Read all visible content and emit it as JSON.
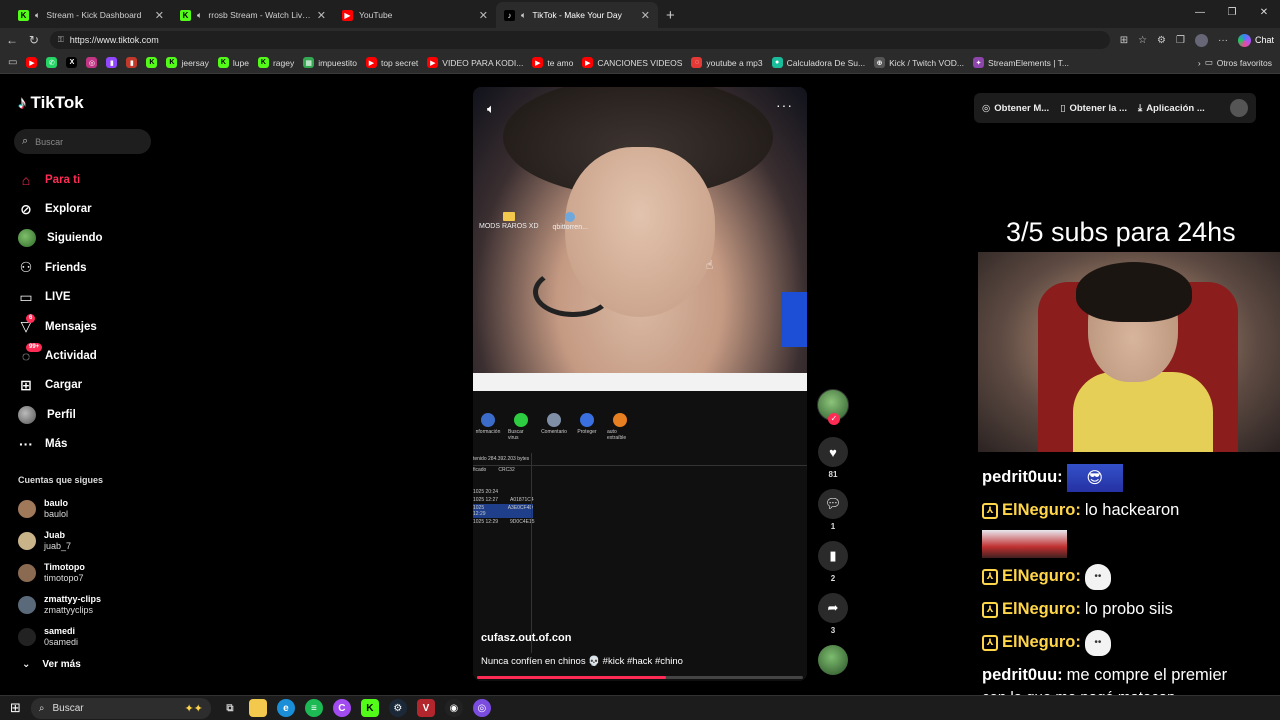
{
  "browser": {
    "tabs": [
      {
        "title": "Stream - Kick Dashboard",
        "fav": "K",
        "fav_color": "#53fc18",
        "audio": true,
        "active": false
      },
      {
        "title": "rrosb Stream - Watch Live on",
        "fav": "K",
        "fav_color": "#53fc18",
        "audio": true,
        "active": false
      },
      {
        "title": "YouTube",
        "fav": "▶",
        "fav_color": "#ff0000",
        "audio": false,
        "active": false
      },
      {
        "title": "TikTok - Make Your Day",
        "fav": "♪",
        "fav_color": "#000000",
        "audio": true,
        "active": true
      }
    ],
    "url": "https://www.tiktok.com",
    "chat_label": "Chat",
    "bookmarks": [
      {
        "label": "",
        "icon": "▶",
        "color": "#ff0000"
      },
      {
        "label": "",
        "icon": "✆",
        "color": "#25d366"
      },
      {
        "label": "",
        "icon": "X",
        "color": "#000000"
      },
      {
        "label": "",
        "icon": "◎",
        "color": "#c13584"
      },
      {
        "label": "",
        "icon": "▮",
        "color": "#9146ff"
      },
      {
        "label": "",
        "icon": "▮",
        "color": "#c0392b"
      },
      {
        "label": "",
        "icon": "K",
        "color": "#53fc18"
      },
      {
        "label": "jeersay",
        "icon": "K",
        "color": "#53fc18"
      },
      {
        "label": "lupe",
        "icon": "K",
        "color": "#53fc18"
      },
      {
        "label": "ragey",
        "icon": "K",
        "color": "#53fc18"
      },
      {
        "label": "impuestito",
        "icon": "▦",
        "color": "#34a853"
      },
      {
        "label": "top secret",
        "icon": "▶",
        "color": "#ff0000"
      },
      {
        "label": "VIDEO PARA KODI...",
        "icon": "▶",
        "color": "#ff0000"
      },
      {
        "label": "te amo",
        "icon": "▶",
        "color": "#ff0000"
      },
      {
        "label": "CANCIONES VIDEOS",
        "icon": "▶",
        "color": "#ff0000"
      },
      {
        "label": "youtube a mp3",
        "icon": "◌",
        "color": "#e53935"
      },
      {
        "label": "Calculadora De Su...",
        "icon": "●",
        "color": "#1abc9c"
      },
      {
        "label": "Kick / Twitch VOD...",
        "icon": "⊕",
        "color": "#555555"
      },
      {
        "label": "StreamElements | T...",
        "icon": "✦",
        "color": "#8e44ad"
      }
    ],
    "other_bookmarks": "Otros favoritos"
  },
  "tiktok": {
    "logo": "TikTok",
    "search_placeholder": "Buscar",
    "menu": [
      {
        "label": "Para ti",
        "icon": "⌂",
        "active": true,
        "badge": ""
      },
      {
        "label": "Explorar",
        "icon": "⊘",
        "active": false,
        "badge": ""
      },
      {
        "label": "Siguiendo",
        "icon": "",
        "active": false,
        "badge": ""
      },
      {
        "label": "Friends",
        "icon": "⚇",
        "active": false,
        "badge": ""
      },
      {
        "label": "LIVE",
        "icon": "▭",
        "active": false,
        "badge": ""
      },
      {
        "label": "Mensajes",
        "icon": "▽",
        "active": false,
        "badge": "6"
      },
      {
        "label": "Actividad",
        "icon": "",
        "active": false,
        "badge": "99+"
      },
      {
        "label": "Cargar",
        "icon": "⊞",
        "active": false,
        "badge": ""
      },
      {
        "label": "Perfil",
        "icon": "",
        "active": false,
        "badge": ""
      },
      {
        "label": "Más",
        "icon": "···",
        "active": false,
        "badge": ""
      }
    ],
    "following_title": "Cuentas que sigues",
    "accounts": [
      {
        "name": "baulo",
        "handle": "baulol",
        "color": "#a0785a"
      },
      {
        "name": "Juab",
        "handle": "juab_7",
        "color": "#c9b48a"
      },
      {
        "name": "Timotopo",
        "handle": "timotopo7",
        "color": "#8a6a50"
      },
      {
        "name": "zmattyy-clips",
        "handle": "zmattyyclips",
        "color": "#5a6a7a"
      },
      {
        "name": "samedi",
        "handle": "0samedi",
        "color": "#222222"
      }
    ],
    "see_more": "Ver más",
    "top_buttons": [
      "Obtener M...",
      "Obtener la ...",
      "Aplicación ..."
    ],
    "video": {
      "author": "cufasz.out.of.con",
      "caption": "Nunca confíen en chinos 💀 #kick #hack #chino",
      "progress": 0.58,
      "desktop_icons": [
        "MODS RAROS XD",
        "qbittorren..."
      ],
      "tools": [
        "nformación",
        "Buscar virus",
        "Comentario",
        "Proteger",
        "auto extraíble"
      ],
      "file_header": "tenido 284.392.203 bytes",
      "file_cols": [
        "ficado",
        "CRC32"
      ],
      "file_rows": [
        {
          "date": "1025 20:24",
          "crc": ""
        },
        {
          "date": "1025 12:27",
          "crc": "A01871C4"
        },
        {
          "date": "1025 12:29",
          "crc": "A3E0CF4D"
        },
        {
          "date": "1025 12:29",
          "crc": "9D0C4E15"
        }
      ]
    },
    "actions": {
      "likes": "81",
      "comments": "1",
      "saves": "2",
      "shares": "3"
    }
  },
  "stream_overlay": {
    "goal": "3/5 subs para 24hs",
    "chat": [
      {
        "user": "pedrit0uu",
        "text": "",
        "sub": false,
        "emote": "pedrito"
      },
      {
        "user": "ElNeguro",
        "text": "lo hackearon",
        "sub": true,
        "emote": ""
      },
      {
        "user": "",
        "text": "",
        "sub": false,
        "emote": "image"
      },
      {
        "user": "ElNeguro",
        "text": "",
        "sub": true,
        "emote": "ghost"
      },
      {
        "user": "ElNeguro",
        "text": "lo probo siis",
        "sub": true,
        "emote": ""
      },
      {
        "user": "ElNeguro",
        "text": "",
        "sub": true,
        "emote": "ghost"
      },
      {
        "user": "pedrit0uu",
        "text": "me compre el premier",
        "sub": false,
        "emote": ""
      }
    ],
    "last_line": "con lo que me pagó matecap"
  },
  "taskbar": {
    "search_placeholder": "Buscar"
  }
}
